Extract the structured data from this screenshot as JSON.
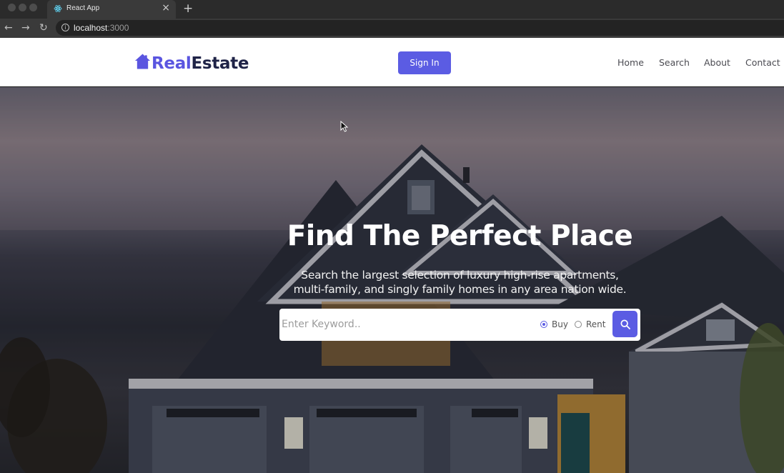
{
  "browser": {
    "tab_title": "React App",
    "tab_close": "×",
    "new_tab": "+",
    "url_host": "localhost",
    "url_port": ":3000",
    "back": "←",
    "forward": "→",
    "reload": "↻",
    "info": "i"
  },
  "header": {
    "brand_part1": "Real",
    "brand_part2": "Estate",
    "signin_label": "Sign In",
    "nav": [
      "Home",
      "Search",
      "About",
      "Contact"
    ]
  },
  "hero": {
    "title": "Find The Perfect Place",
    "subtitle_line1": "Search the largest selection of luxury high-rise apartments,",
    "subtitle_line2": "multi-family, and singly family homes in any area nation wide."
  },
  "search": {
    "placeholder": "Enter Keyword..",
    "options": [
      "Buy",
      "Rent"
    ],
    "selected": "Buy"
  },
  "colors": {
    "accent": "#5b5ce3",
    "brand_dark": "#1f2347"
  }
}
